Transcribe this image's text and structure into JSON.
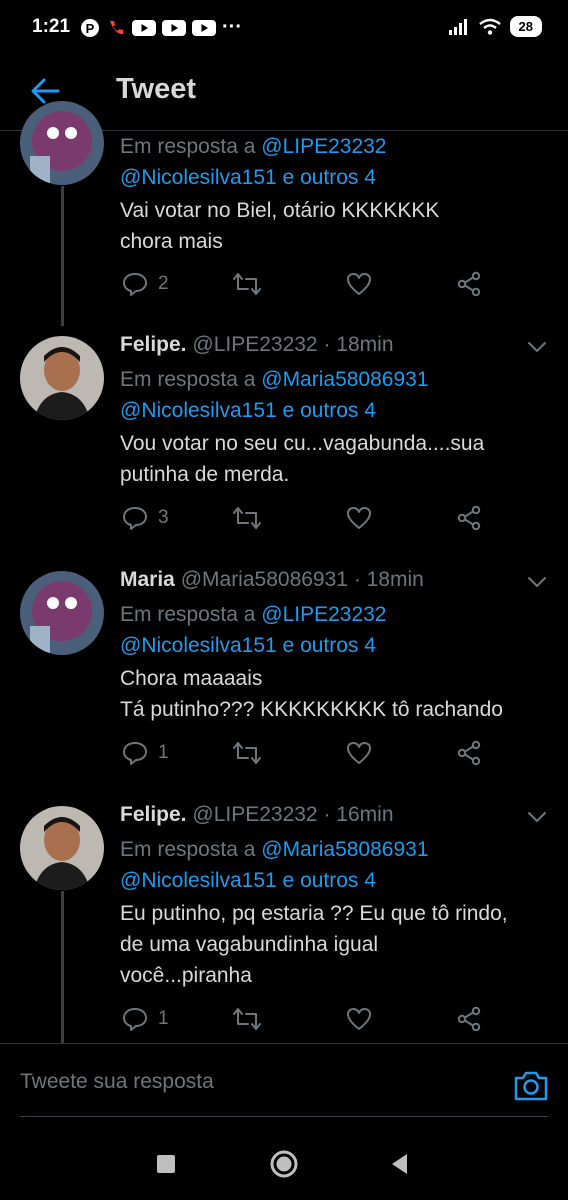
{
  "status_bar": {
    "time": "1:21",
    "battery": "28",
    "dots": "···"
  },
  "app_bar": {
    "title": "Tweet"
  },
  "tweets": [
    {
      "name": "",
      "handle": "",
      "time": "",
      "reply_prefix": "Em resposta a",
      "reply_to": "@LIPE23232",
      "reply_to_2": "@Nicolesilva151 e outros 4",
      "text_lines": [
        "Vai votar no Biel, otário KKKKKKK",
        "chora mais"
      ],
      "reply_count": "2"
    },
    {
      "name": "Felipe.",
      "handle": "@LIPE23232",
      "time": "· 18min",
      "reply_prefix": "Em resposta a",
      "reply_to": "@Maria58086931",
      "reply_to_2": "@Nicolesilva151 e outros 4",
      "text_lines": [
        "Vou votar no seu cu...vagabunda....sua",
        "putinha de merda."
      ],
      "reply_count": "3"
    },
    {
      "name": "Maria",
      "handle": "@Maria58086931",
      "time": "· 18min",
      "reply_prefix": "Em resposta a",
      "reply_to": "@LIPE23232",
      "reply_to_2": "@Nicolesilva151 e outros 4",
      "text_lines": [
        "Chora maaaais",
        "Tá putinho??? KKKKKKKKK tô rachando"
      ],
      "reply_count": "1"
    },
    {
      "name": "Felipe.",
      "handle": "@LIPE23232",
      "time": "· 16min",
      "reply_prefix": "Em resposta a",
      "reply_to": "@Maria58086931",
      "reply_to_2": "@Nicolesilva151 e outros 4",
      "text_lines": [
        "Eu putinho, pq estaria ?? Eu que tô rindo,",
        "de uma vagabundinha igual",
        "você...piranha"
      ],
      "reply_count": "1"
    }
  ],
  "reply_bar": {
    "placeholder": "Tweete sua resposta"
  },
  "colors": {
    "background": "#000000",
    "accent": "#1d9bf0",
    "muted": "#6e767d",
    "text": "#d9d9d9"
  },
  "icons": {
    "back": "arrow-left-icon",
    "reply": "comment-icon",
    "retweet": "retweet-icon",
    "like": "heart-icon",
    "share": "share-icon",
    "camera": "camera-icon",
    "more": "chevron-down-icon"
  }
}
